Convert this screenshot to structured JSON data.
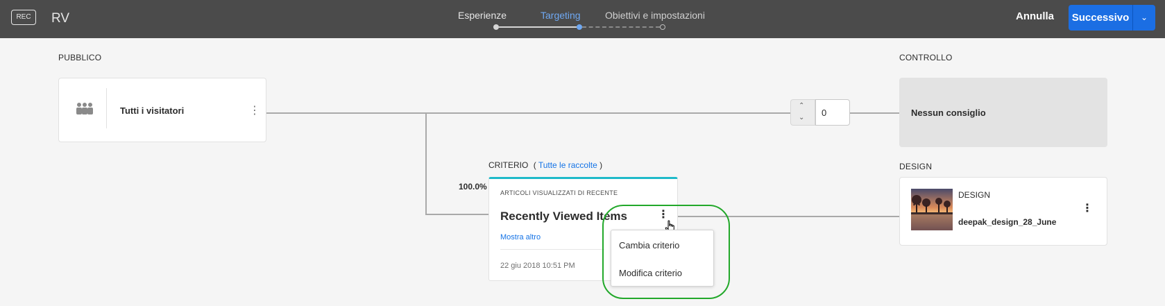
{
  "header": {
    "rec_label": "REC",
    "app_name": "RV",
    "steps": [
      {
        "label": "Esperienze",
        "state": "done"
      },
      {
        "label": "Targeting",
        "state": "current"
      },
      {
        "label": "Obiettivi e impostazioni",
        "state": "future"
      }
    ],
    "cancel_label": "Annulla",
    "next_label": "Successivo"
  },
  "audience": {
    "section_label": "PUBBLICO",
    "name": "Tutti i visitatori",
    "icon": "users-icon"
  },
  "allocation": {
    "value": "0"
  },
  "control": {
    "section_label": "CONTROLLO",
    "text": "Nessun consiglio"
  },
  "criteria": {
    "section_label": "CRITERIO",
    "link_open": "(",
    "link_label": "Tutte le raccolte",
    "link_close": ")",
    "percentage": "100.0%",
    "card": {
      "subtitle": "ARTICOLI VISUALIZZATI DI RECENTE",
      "name": "Recently Viewed Items",
      "show_more": "Mostra altro",
      "date": "22 giu 2018 10:51 PM"
    },
    "menu": {
      "items": [
        "Cambia criterio",
        "Modifica criterio"
      ]
    }
  },
  "design": {
    "section_label": "DESIGN",
    "card_label": "DESIGN",
    "name": "deepak_design_28_June"
  },
  "colors": {
    "header_bg": "#4b4b4b",
    "accent_blue": "#1b6ee3",
    "active_step": "#6fa8f2",
    "criteria_bar": "#1fbac9",
    "highlight": "#22a82a"
  }
}
